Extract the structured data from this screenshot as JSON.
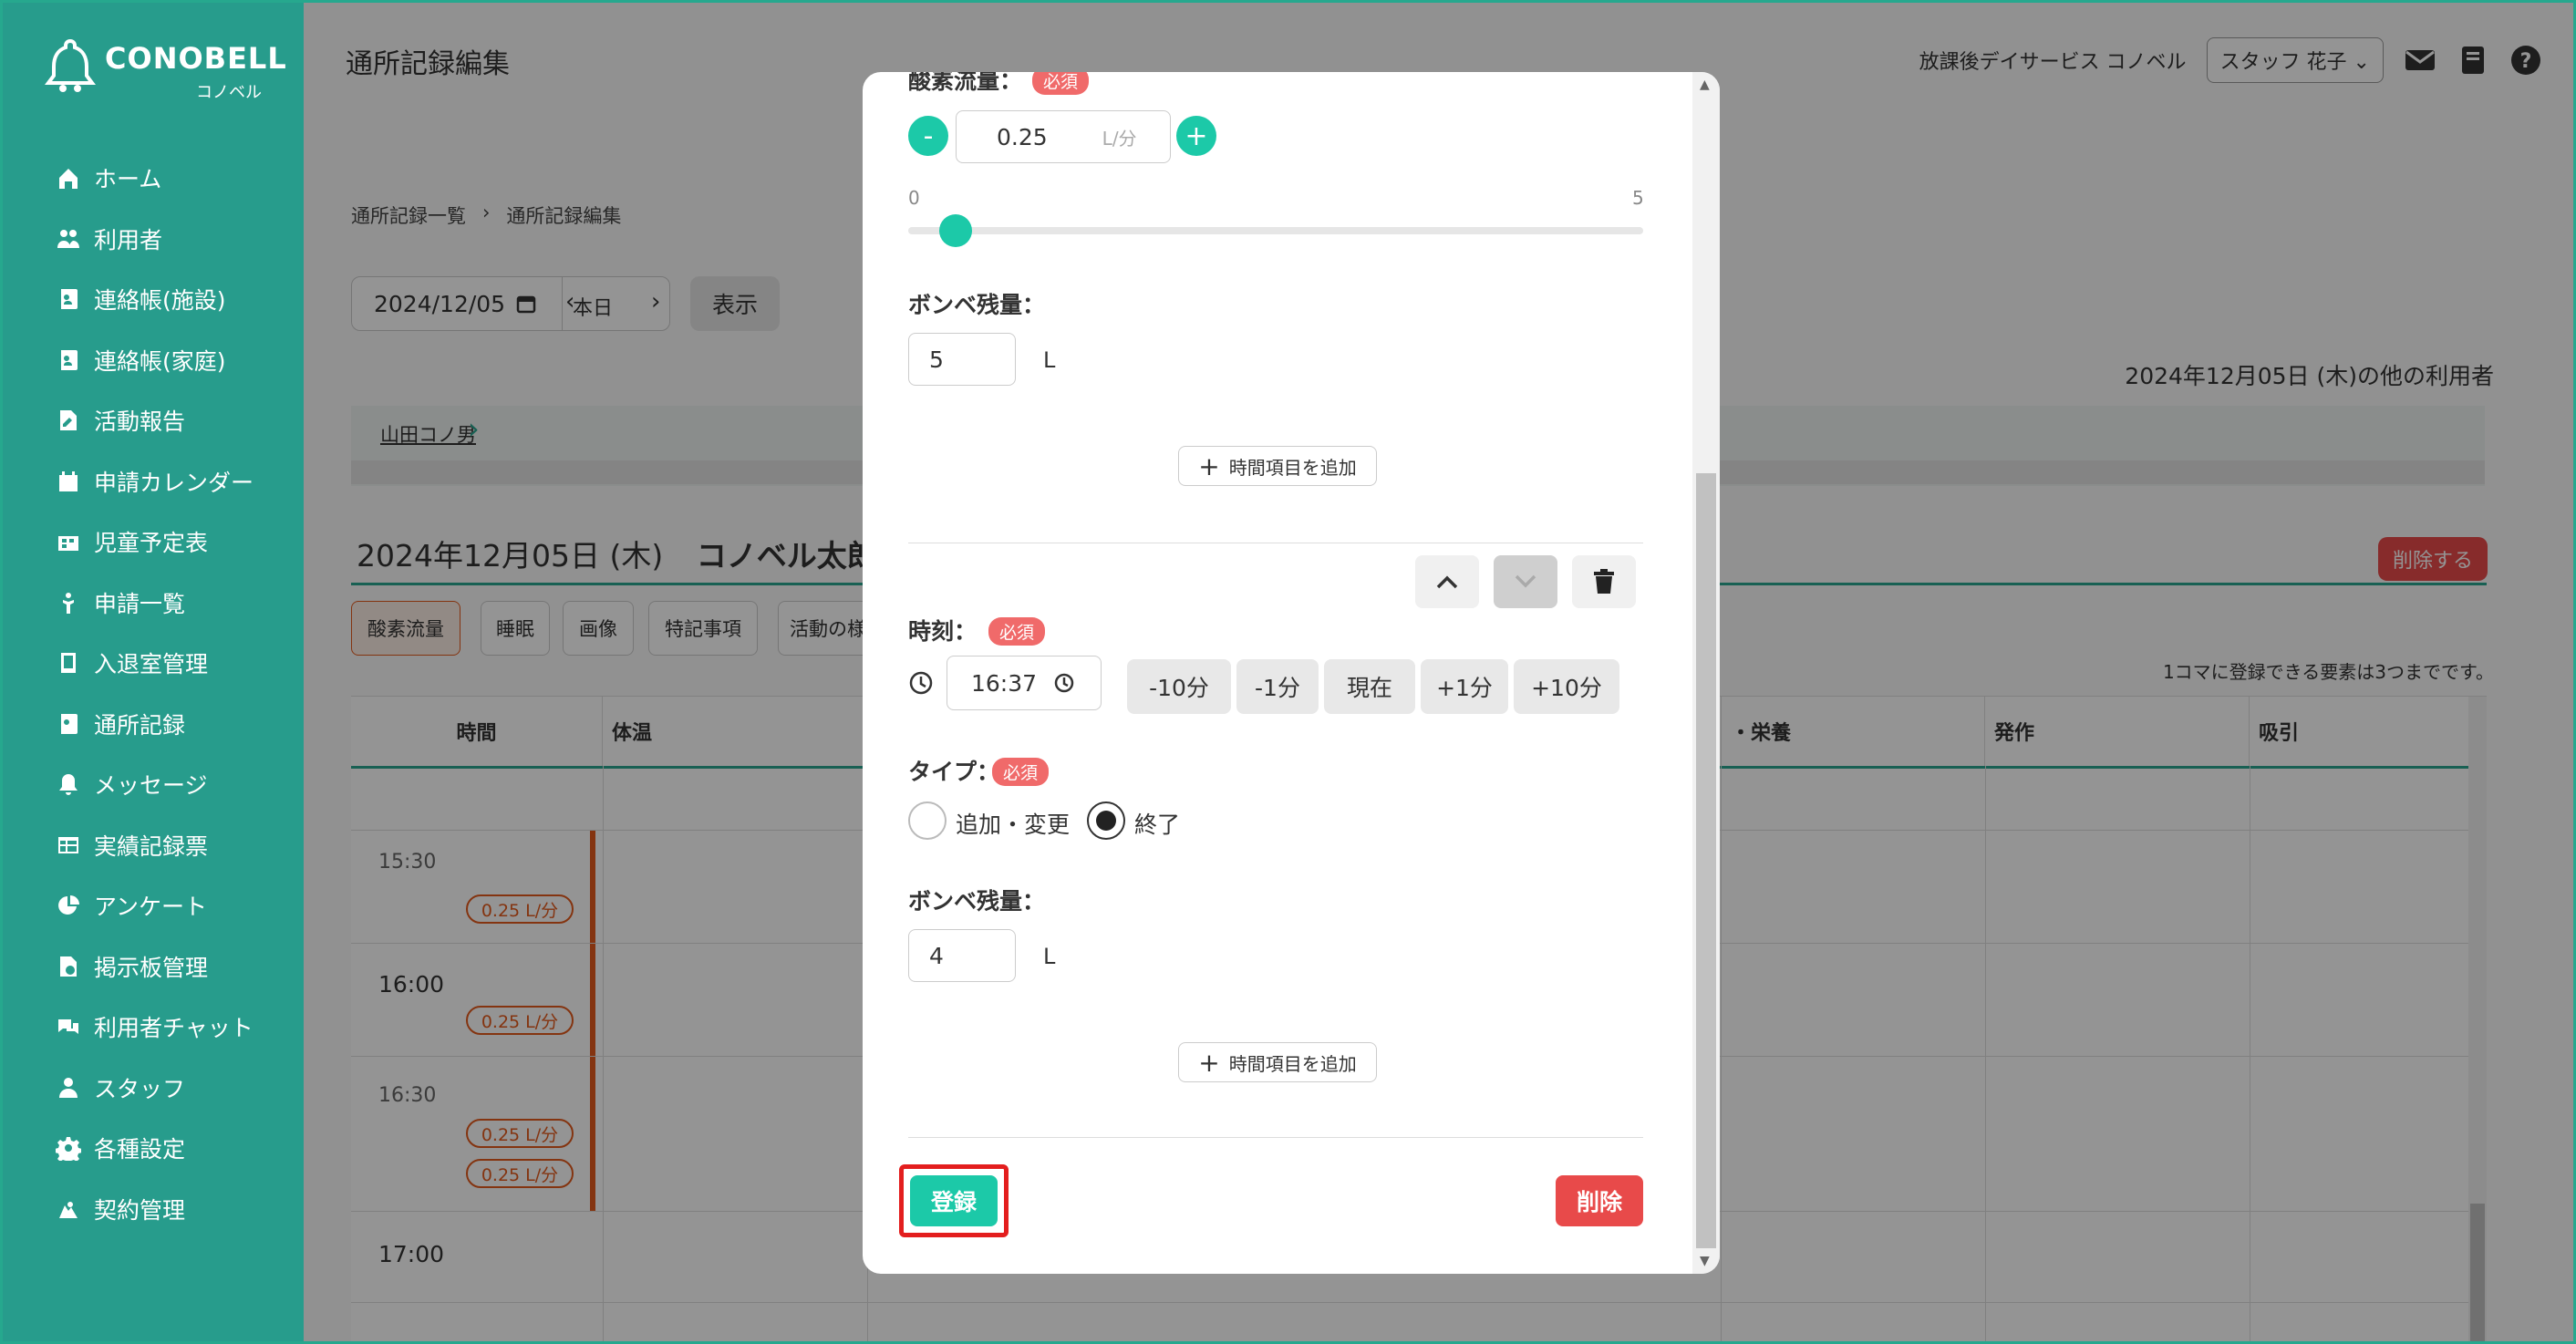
{
  "app": {
    "logo": "CONOBELL",
    "logo_sub": "コノベル"
  },
  "sidebar": {
    "items": [
      {
        "label": "ホーム",
        "icon": "home-icon"
      },
      {
        "label": "利用者",
        "icon": "users-icon"
      },
      {
        "label": "連絡帳(施設)",
        "icon": "contact-book-icon"
      },
      {
        "label": "連絡帳(家庭)",
        "icon": "contact-book-icon"
      },
      {
        "label": "活動報告",
        "icon": "report-icon"
      },
      {
        "label": "申請カレンダー",
        "icon": "calendar-icon"
      },
      {
        "label": "児童予定表",
        "icon": "schedule-icon"
      },
      {
        "label": "申請一覧",
        "icon": "person-icon"
      },
      {
        "label": "入退室管理",
        "icon": "tablet-icon"
      },
      {
        "label": "通所記録",
        "icon": "record-icon"
      },
      {
        "label": "メッセージ",
        "icon": "bell-icon"
      },
      {
        "label": "実績記録票",
        "icon": "table-icon"
      },
      {
        "label": "アンケート",
        "icon": "pie-icon"
      },
      {
        "label": "掲示板管理",
        "icon": "board-icon"
      },
      {
        "label": "利用者チャット",
        "icon": "chat-icon"
      },
      {
        "label": "スタッフ",
        "icon": "staff-icon"
      },
      {
        "label": "各種設定",
        "icon": "gear-icon"
      },
      {
        "label": "契約管理",
        "icon": "contract-icon"
      }
    ]
  },
  "header": {
    "title": "通所記録編集",
    "facility": "放課後デイサービス コノベル",
    "staff": "スタッフ 花子"
  },
  "breadcrumb": {
    "list": "通所記録一覧",
    "current": "通所記録編集"
  },
  "datebar": {
    "date": "2024/12/05",
    "today": "本日",
    "show": "表示"
  },
  "other_users_label": "2024年12月05日 (木)の他の利用者",
  "user_strip_name": "山田コノ男",
  "record_header": {
    "date": "2024年12月05日 (木)",
    "name": "コノベル太郎",
    "delete": "削除する"
  },
  "chips": [
    "酸素流量",
    "睡眠",
    "画像",
    "特記事項",
    "活動の様"
  ],
  "limit_note": "1コマに登録できる要素は3つまでです。",
  "table": {
    "headers": [
      "時間",
      "体温",
      "・栄養",
      "発作",
      "吸引"
    ],
    "rows": [
      {
        "time": "15:30",
        "pills": [
          "0.25 L/分"
        ]
      },
      {
        "time": "16:00",
        "pills": [
          "0.25 L/分"
        ]
      },
      {
        "time": "16:30",
        "pills": [
          "0.25 L/分",
          "0.25 L/分"
        ]
      },
      {
        "time": "17:00",
        "pills": []
      }
    ]
  },
  "modal": {
    "flow_label": "酸素流量：",
    "required": "必須",
    "flow_value": "0.25",
    "flow_unit": "L/分",
    "slider_min": "0",
    "slider_max": "5",
    "slider_value": 0.25,
    "tank1_label": "ボンベ残量：",
    "tank1_value": "5",
    "unit_l": "L",
    "add_time": "時間項目を追加",
    "time_label": "時刻：",
    "time_value": "16:37",
    "time_buttons": [
      "-10分",
      "-1分",
      "現在",
      "+1分",
      "+10分"
    ],
    "type_label": "タイプ：",
    "type_options": [
      "追加・変更",
      "終了"
    ],
    "type_selected": "終了",
    "tank2_label": "ボンベ残量：",
    "tank2_value": "4",
    "register": "登録",
    "delete": "削除"
  }
}
